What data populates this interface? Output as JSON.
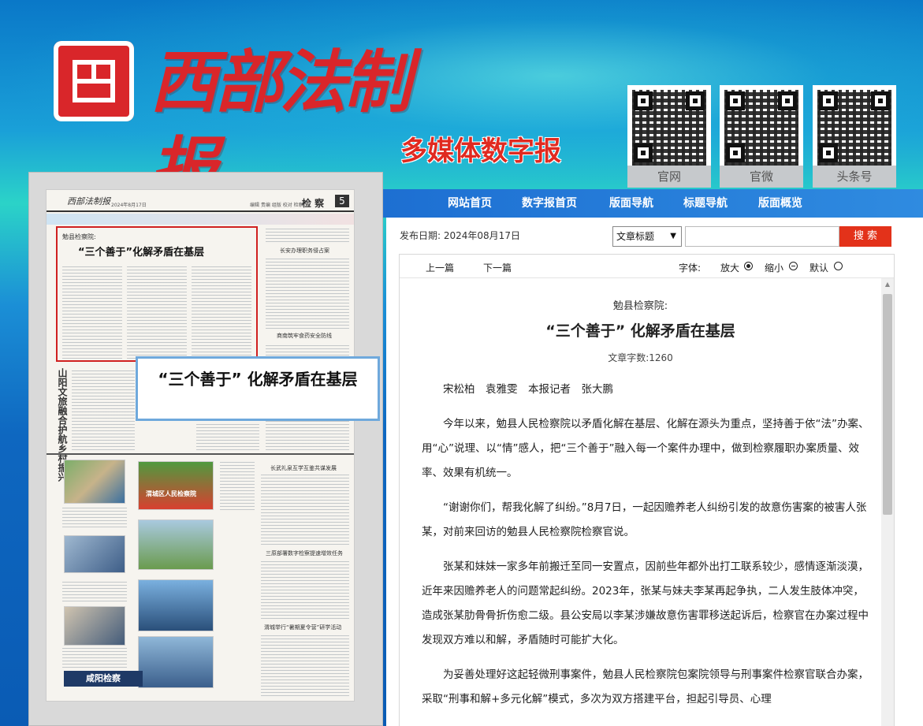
{
  "header": {
    "masthead": "西部法制报",
    "subtitle": "多媒体数字报",
    "qr_codes": [
      {
        "label": "官网"
      },
      {
        "label": "官微"
      },
      {
        "label": "头条号"
      }
    ]
  },
  "nav": {
    "items": [
      "网站首页",
      "数字报首页",
      "版面导航",
      "标题导航",
      "版面概览"
    ]
  },
  "thumbnail": {
    "brand": "西部法制报",
    "date": "2024年8月17日",
    "nav_text": "编辑 责编 组版 校对 检察",
    "section": "检 察",
    "page_num": "5",
    "headline_kicker": "勉县检察院:",
    "headline": "“三个善于”化解矛盾在基层",
    "side_titles": [
      "长安办理职务侵占案",
      "商南筑牢食药安全防线",
      "长武礼泉互学互鉴共谋发展",
      "三原部署数字检察提速增效任务",
      "渭城举行“暑期夏令营”研学活动"
    ],
    "vertical_title": "山阳文旅融合护航乡村振兴",
    "footer_label": "咸阳检察",
    "photo_banner": "渭城区人民检察院",
    "tooltip": "“三个善于” 化解矛盾在基层"
  },
  "toolbar": {
    "pub_date_label": "发布日期:",
    "pub_date": "2024年08月17日",
    "select_value": "文章标题",
    "search_placeholder": "",
    "search_button": "搜 索"
  },
  "article_toolbar": {
    "prev": "上一篇",
    "next": "下一篇",
    "font_label": "字体:",
    "bigger": "放大",
    "smaller": "缩小",
    "default": "默认"
  },
  "article": {
    "kicker": "勉县检察院:",
    "title": "“三个善于” 化解矛盾在基层",
    "word_count": "文章字数:1260",
    "byline": "宋松柏　袁雅雯　本报记者　张大鹏",
    "paragraphs": [
      "今年以来，勉县人民检察院以矛盾化解在基层、化解在源头为重点，坚持善于依“法”办案、用“心”说理、以“情”感人，把“三个善于”融入每一个案件办理中，做到检察履职办案质量、效率、效果有机统一。",
      "“谢谢你们，帮我化解了纠纷。”8月7日，一起因赡养老人纠纷引发的故意伤害案的被害人张某，对前来回访的勉县人民检察院检察官说。",
      "张某和妹妹一家多年前搬迁至同一安置点，因前些年都外出打工联系较少，感情逐渐淡漠，近年来因赡养老人的问题常起纠纷。2023年，张某与妹夫李某再起争执，二人发生肢体冲突，造成张某肋骨骨折伤愈二级。县公安局以李某涉嫌故意伤害罪移送起诉后，检察官在办案过程中发现双方难以和解，矛盾随时可能扩大化。",
      "为妥善处理好这起轻微刑事案件，勉县人民检察院包案院领导与刑事案件检察官联合办案，采取“刑事和解+多元化解”模式，多次为双方搭建平台，担起引导员、心理"
    ]
  }
}
